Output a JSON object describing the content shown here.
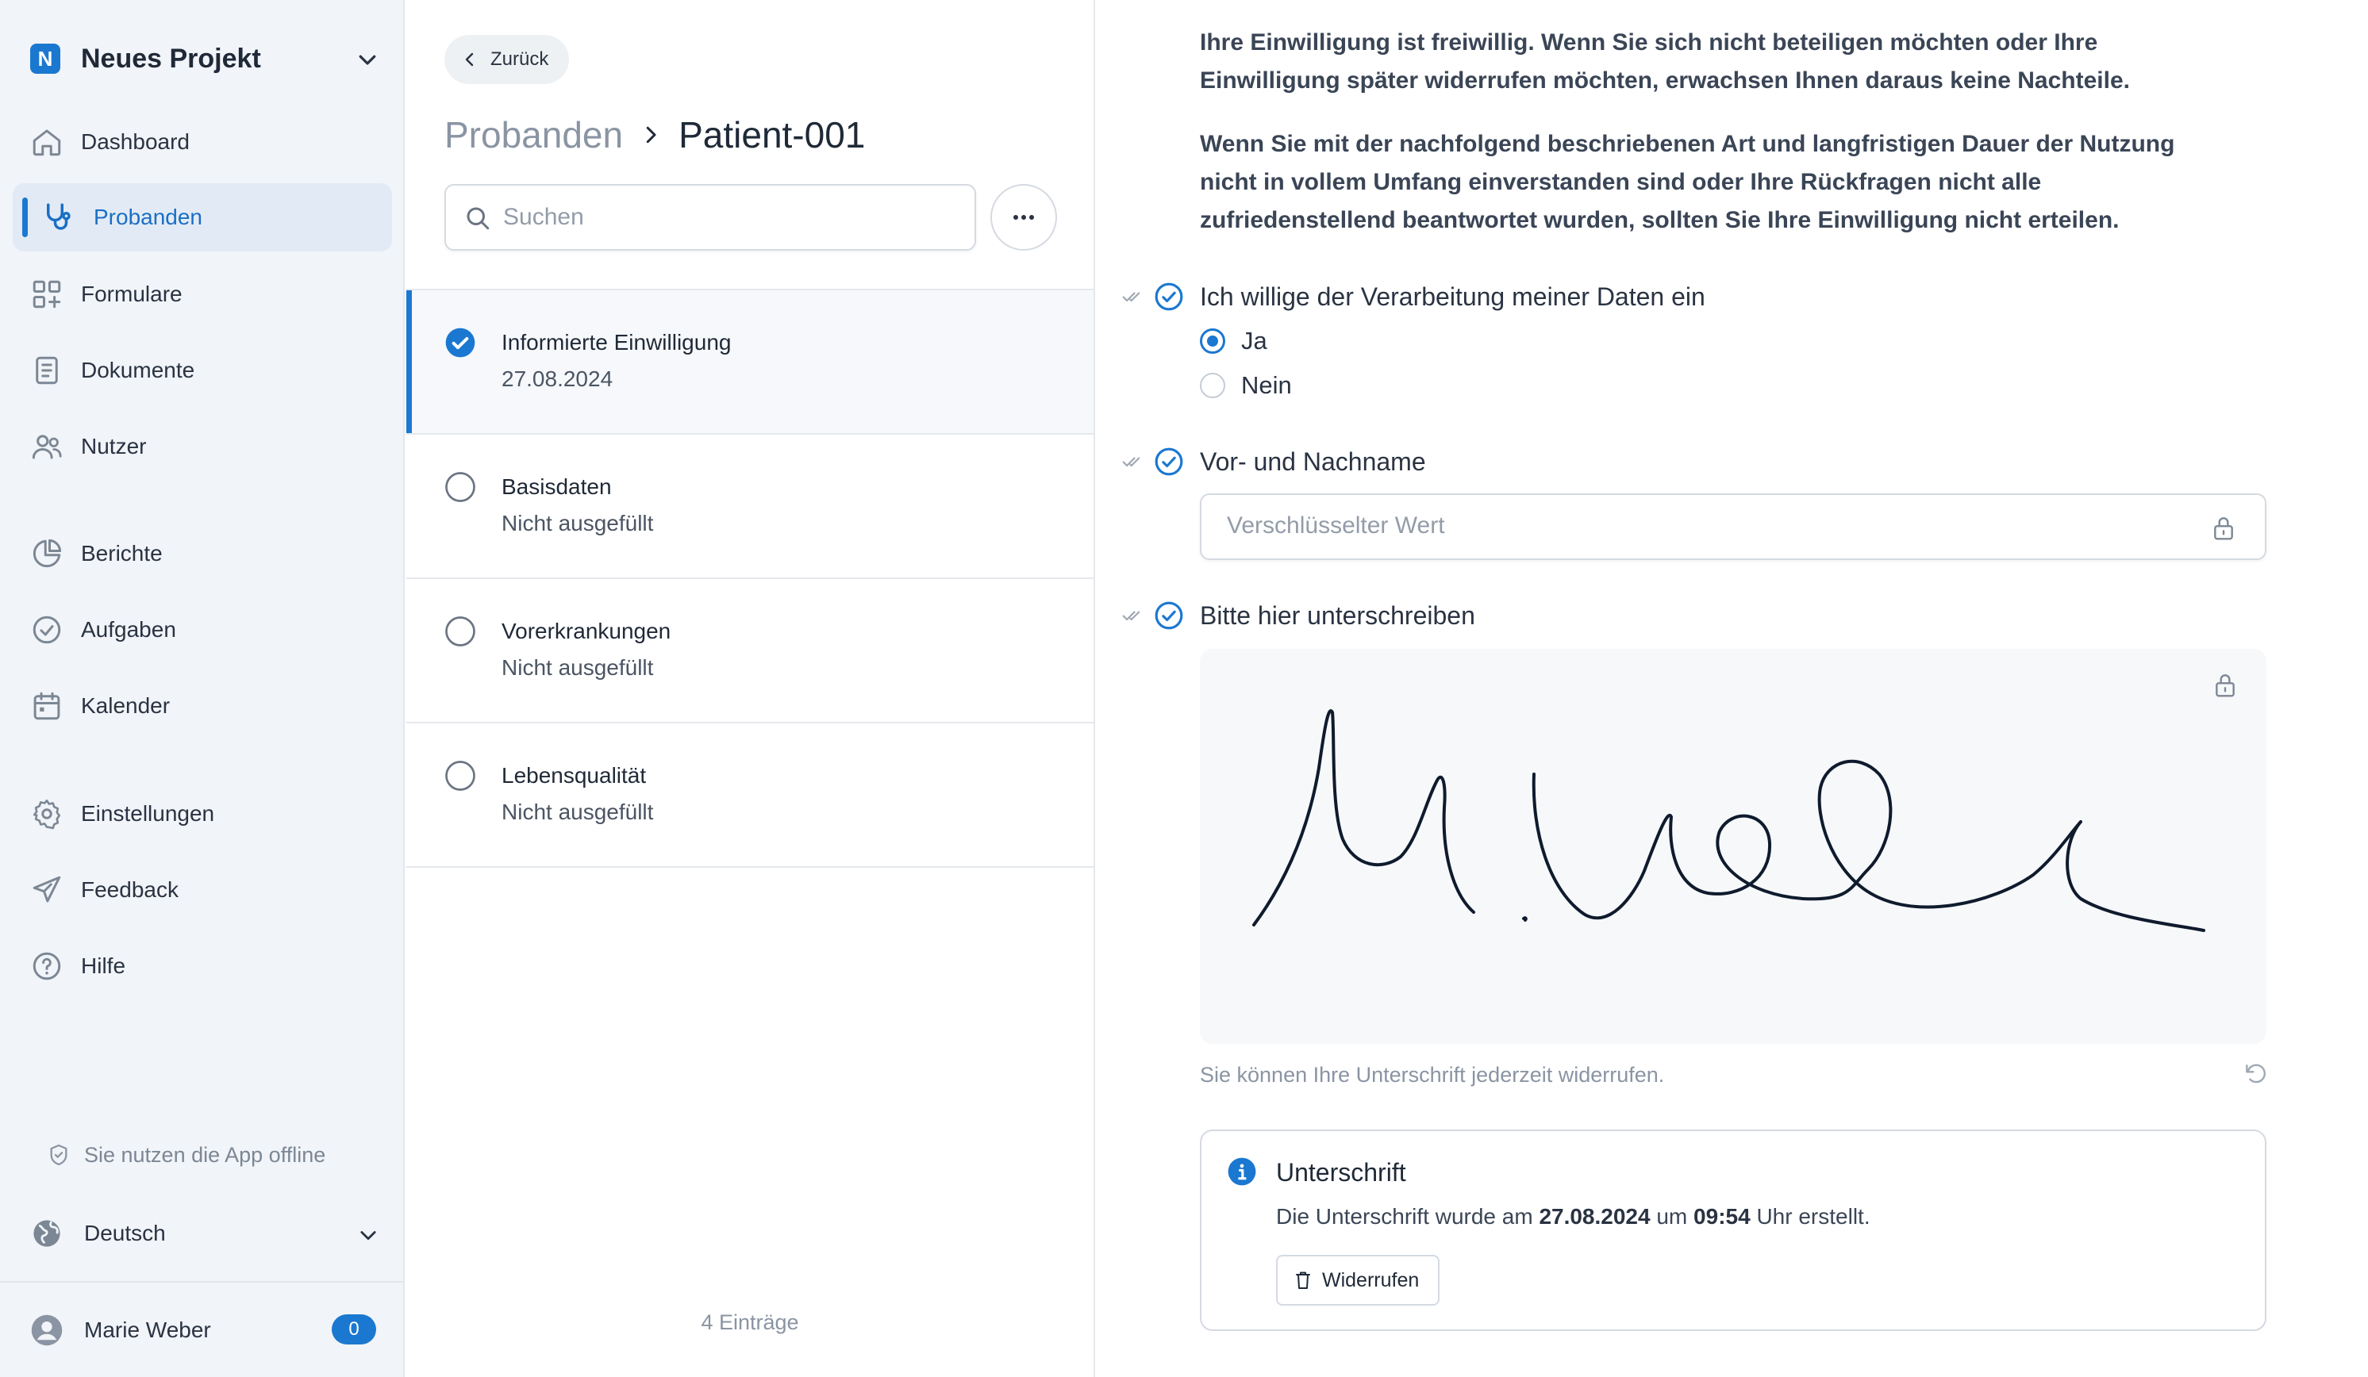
{
  "sidebar": {
    "project_name": "Neues Projekt",
    "project_logo_letter": "N",
    "nav": [
      {
        "label": "Dashboard",
        "icon": "home-icon"
      },
      {
        "label": "Probanden",
        "icon": "stethoscope-icon",
        "active": true
      },
      {
        "label": "Formulare",
        "icon": "grid-plus-icon"
      },
      {
        "label": "Dokumente",
        "icon": "document-icon"
      },
      {
        "label": "Nutzer",
        "icon": "users-icon"
      },
      {
        "label": "Berichte",
        "icon": "pie-chart-icon"
      },
      {
        "label": "Aufgaben",
        "icon": "check-circle-icon"
      },
      {
        "label": "Kalender",
        "icon": "calendar-icon"
      },
      {
        "label": "Einstellungen",
        "icon": "gear-icon"
      },
      {
        "label": "Feedback",
        "icon": "send-icon"
      },
      {
        "label": "Hilfe",
        "icon": "help-icon"
      }
    ],
    "offline_text": "Sie nutzen die App offline",
    "language": "Deutsch",
    "user_name": "Marie Weber",
    "notification_count": "0"
  },
  "middle": {
    "back_label": "Zurück",
    "breadcrumb_root": "Probanden",
    "breadcrumb_current": "Patient-001",
    "search_placeholder": "Suchen",
    "forms": [
      {
        "title": "Informierte Einwilligung",
        "status": "27.08.2024",
        "completed": true
      },
      {
        "title": "Basisdaten",
        "status": "Nicht ausgefüllt",
        "completed": false
      },
      {
        "title": "Vorerkrankungen",
        "status": "Nicht ausgefüllt",
        "completed": false
      },
      {
        "title": "Lebensqualität",
        "status": "Nicht ausgefüllt",
        "completed": false
      }
    ],
    "entry_count": "4 Einträge"
  },
  "content": {
    "paragraph_1": "Ihre Einwilligung ist freiwillig. Wenn Sie sich nicht beteiligen möchten oder Ihre Einwilligung später widerrufen möchten, erwachsen Ihnen daraus keine Nachteile.",
    "paragraph_2": "Wenn Sie mit der nachfolgend beschriebenen Art und langfristigen Dauer der Nutzung nicht in vollem Umfang einverstanden sind oder Ihre Rückfragen nicht alle zufriedenstellend beantwortet wurden, sollten Sie Ihre Einwilligung nicht erteilen.",
    "question_consent": "Ich willige der Verarbeitung meiner Daten ein",
    "option_yes": "Ja",
    "option_no": "Nein",
    "selected_option": "Ja",
    "question_name": "Vor- und Nachname",
    "name_placeholder": "Verschlüsselter Wert",
    "question_signature": "Bitte hier unterschreiben",
    "signature_hint": "Sie können Ihre Unterschrift jederzeit widerrufen.",
    "info": {
      "title": "Unterschrift",
      "msg_prefix": "Die Unterschrift wurde am",
      "date": "27.08.2024",
      "msg_mid": "um",
      "time": "09:54",
      "msg_suffix": "Uhr erstellt.",
      "revoke_label": "Widerrufen"
    }
  },
  "colors": {
    "accent": "#1b78d0",
    "sidebar_bg": "#f1f4f8",
    "active_bg": "#e2ebf5"
  }
}
